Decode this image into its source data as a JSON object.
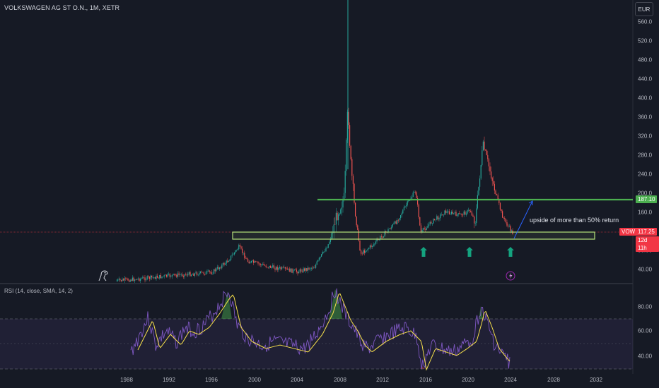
{
  "header": {
    "title": "VOLKSWAGEN AG ST O.N., 1M, XETR",
    "currency_button": "EUR"
  },
  "price_axis": {
    "ticks": [
      "560.0",
      "520.0",
      "480.0",
      "440.0",
      "400.0",
      "360.0",
      "320.0",
      "280.0",
      "240.0",
      "200.0",
      "160.0",
      "120.0",
      "80.00",
      "40.00"
    ]
  },
  "rsi_axis": {
    "ticks": [
      "80.00",
      "60.00",
      "40.00"
    ]
  },
  "time_axis": {
    "ticks": [
      "1988",
      "1992",
      "1996",
      "2000",
      "2004",
      "2008",
      "2012",
      "2016",
      "2020",
      "2024",
      "2028",
      "2032"
    ]
  },
  "tags": {
    "resistance": "187.10",
    "symbol": "VOW",
    "last_price": "117.25",
    "countdown": "12d 11h"
  },
  "annotation": "upside of more than 50% return",
  "rsi_indicator": {
    "title": "RSI (14, close, SMA, 14, 2)"
  },
  "colors": {
    "background": "#161a25",
    "up": "#26a69a",
    "down": "#ef5350",
    "support_zone": "#b5e37a",
    "resistance_line": "#4caf50",
    "arrow": "#14a37f",
    "rsi_line": "#7e57c2",
    "rsi_sma": "#f7e04b",
    "projection": "#2962ff",
    "price_tag": "#f23645"
  }
}
